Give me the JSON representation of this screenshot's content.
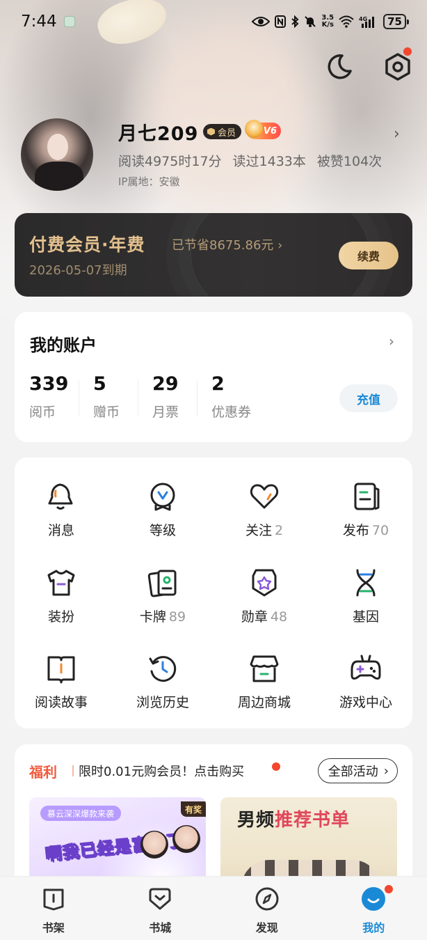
{
  "status_bar": {
    "time": "7:44",
    "net_speed_value": "3.5",
    "net_speed_unit": "K/s",
    "battery": "75"
  },
  "profile": {
    "name": "月七209",
    "member_badge": "会员",
    "vip_level": "V6",
    "read_time": "阅读4975时17分",
    "books_read": "读过1433本",
    "likes": "被赞104次",
    "ip_location": "IP属地：安徽"
  },
  "vip_card": {
    "title": "付费会员·年费",
    "saved": "已节省8675.86元 ›",
    "expire": "2026-05-07到期",
    "renew_button": "续费"
  },
  "account": {
    "title": "我的账户",
    "items": [
      {
        "value": "339",
        "label": "阅币"
      },
      {
        "value": "5",
        "label": "赠币"
      },
      {
        "value": "29",
        "label": "月票"
      },
      {
        "value": "2",
        "label": "优惠券"
      }
    ],
    "recharge_button": "充值"
  },
  "grid": [
    {
      "label": "消息",
      "count": "",
      "icon": "bell-icon"
    },
    {
      "label": "等级",
      "count": "",
      "icon": "level-badge-icon"
    },
    {
      "label": "关注",
      "count": "2",
      "icon": "heart-icon"
    },
    {
      "label": "发布",
      "count": "70",
      "icon": "publish-icon"
    },
    {
      "label": "装扮",
      "count": "",
      "icon": "tshirt-icon"
    },
    {
      "label": "卡牌",
      "count": "89",
      "icon": "cards-icon"
    },
    {
      "label": "勋章",
      "count": "48",
      "icon": "medal-icon"
    },
    {
      "label": "基因",
      "count": "",
      "icon": "dna-icon"
    },
    {
      "label": "阅读故事",
      "count": "",
      "icon": "book-icon"
    },
    {
      "label": "浏览历史",
      "count": "",
      "icon": "history-icon"
    },
    {
      "label": "周边商城",
      "count": "",
      "icon": "shop-icon"
    },
    {
      "label": "游戏中心",
      "count": "",
      "icon": "gamepad-icon"
    }
  ],
  "welfare": {
    "tag": "福利",
    "text": "限时0.01元购会员！点击购买",
    "all_button": "全部活动",
    "banner_left": {
      "subtitle": "慕云深深爆款来袭",
      "prize": "有奖",
      "headline": "啊我已经是富婆了"
    },
    "banner_right": {
      "title_plain": "男频",
      "title_accent": "推荐书单"
    }
  },
  "bottom_nav": [
    {
      "label": "书架",
      "icon": "bookshelf-icon",
      "active": false
    },
    {
      "label": "书城",
      "icon": "bookstore-icon",
      "active": false
    },
    {
      "label": "发现",
      "icon": "discover-icon",
      "active": false
    },
    {
      "label": "我的",
      "icon": "profile-face-icon",
      "active": true
    }
  ],
  "colors": {
    "accent": "#1a8ad6",
    "vip_gold": "#e3c08e",
    "vip_card_bg": "#2b2a2a",
    "notification_red": "#f2472f",
    "welfare_red": "#f05a3c",
    "icon_orange": "#f08a2c",
    "icon_blue": "#2d7fe0",
    "icon_green": "#27b36b"
  }
}
